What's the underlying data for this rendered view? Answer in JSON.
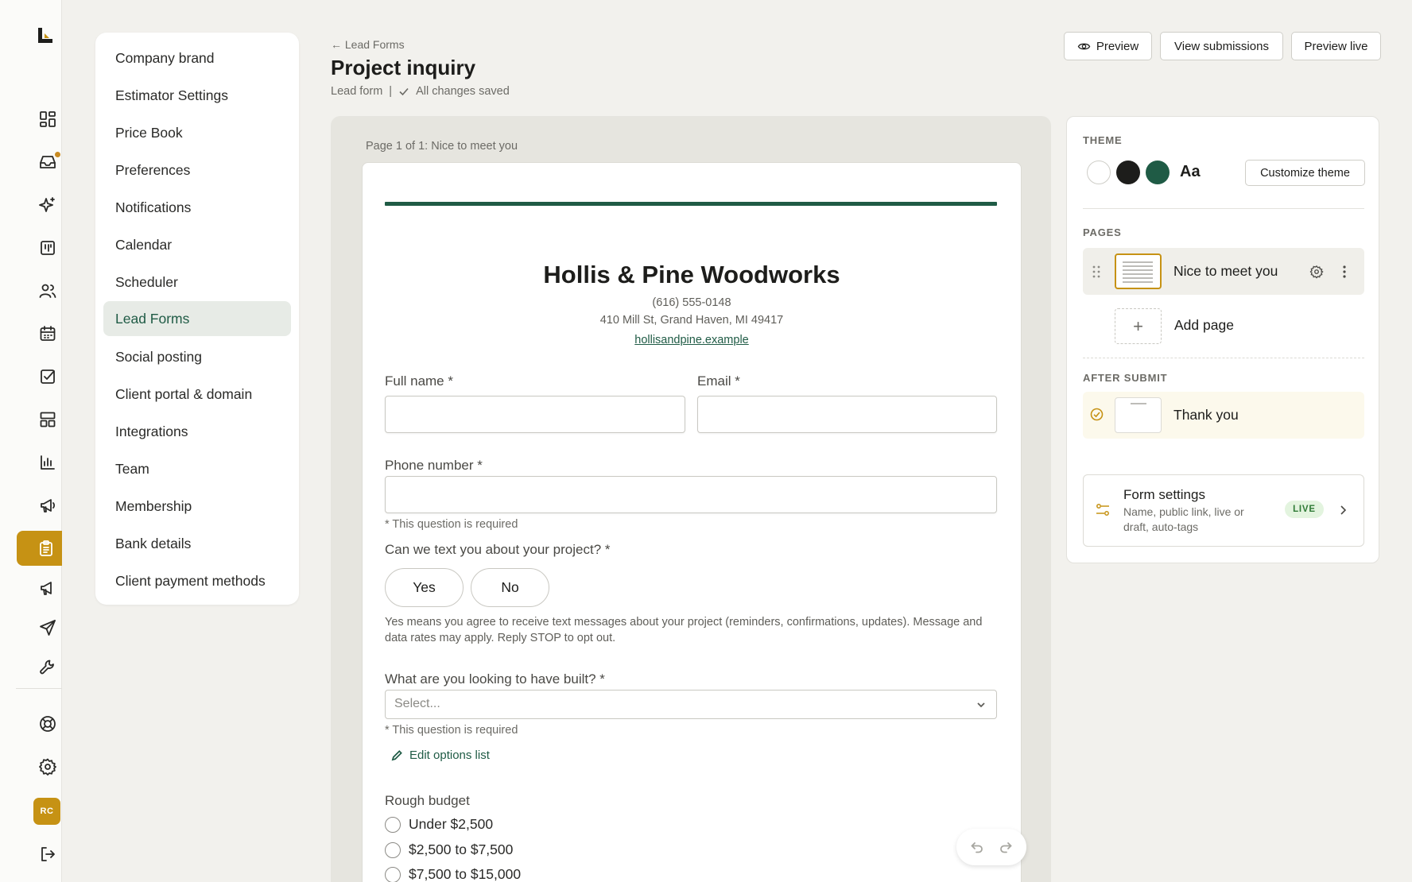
{
  "rail": {
    "avatar_initials": "RC"
  },
  "settings_nav": {
    "items": [
      "Company brand",
      "Estimator Settings",
      "Price Book",
      "Preferences",
      "Notifications",
      "Calendar",
      "Scheduler",
      "Lead Forms",
      "Social posting",
      "Client portal & domain",
      "Integrations",
      "Team",
      "Membership",
      "Bank details",
      "Client payment methods"
    ],
    "active": "Lead Forms"
  },
  "header": {
    "back_label": "← Lead Forms",
    "title": "Project inquiry",
    "form_type": "Lead form",
    "separator": "|",
    "save_status": "All changes saved",
    "buttons": {
      "preview": "Preview",
      "view_submissions": "View submissions",
      "preview_live": "Preview live"
    }
  },
  "canvas": {
    "page_label": "Page 1 of 1: Nice to meet you"
  },
  "form": {
    "business_name": "Hollis & Pine Woodworks",
    "phone": "(616) 555-0148",
    "address": "410 Mill St, Grand Haven, MI 49417",
    "website": "hollisandpine.example",
    "full_name_label": "Full name *",
    "email_label": "Email *",
    "phone_label": "Phone number *",
    "required_hint": "* This question is required",
    "text_question": "Can we text you about your project? *",
    "yes_label": "Yes",
    "no_label": "No",
    "consent_text": "Yes means you agree to receive text messages about your project (reminders, confirmations, updates). Message and data rates may apply. Reply STOP to opt out.",
    "build_question": "What are you looking to have built? *",
    "select_placeholder": "Select...",
    "edit_options_label": "Edit options list",
    "budget_label": "Rough budget",
    "budget_options": [
      "Under $2,500",
      "$2,500 to $7,500",
      "$7,500 to $15,000"
    ]
  },
  "panel": {
    "theme_title": "THEME",
    "theme_colors": [
      "#ffffff",
      "#1d1d1b",
      "#1f5b45"
    ],
    "theme_font_glyph": "Aa",
    "customize_label": "Customize theme",
    "pages_title": "PAGES",
    "page_name": "Nice to meet you",
    "add_page_label": "Add page",
    "after_submit_title": "AFTER SUBMIT",
    "after_submit_page": "Thank you",
    "form_settings_title": "Form settings",
    "form_settings_desc": "Name, public link, live or draft, auto-tags",
    "live_badge": "LIVE"
  },
  "colors": {
    "accent": "#c69214",
    "brand_green": "#1f5b45"
  }
}
